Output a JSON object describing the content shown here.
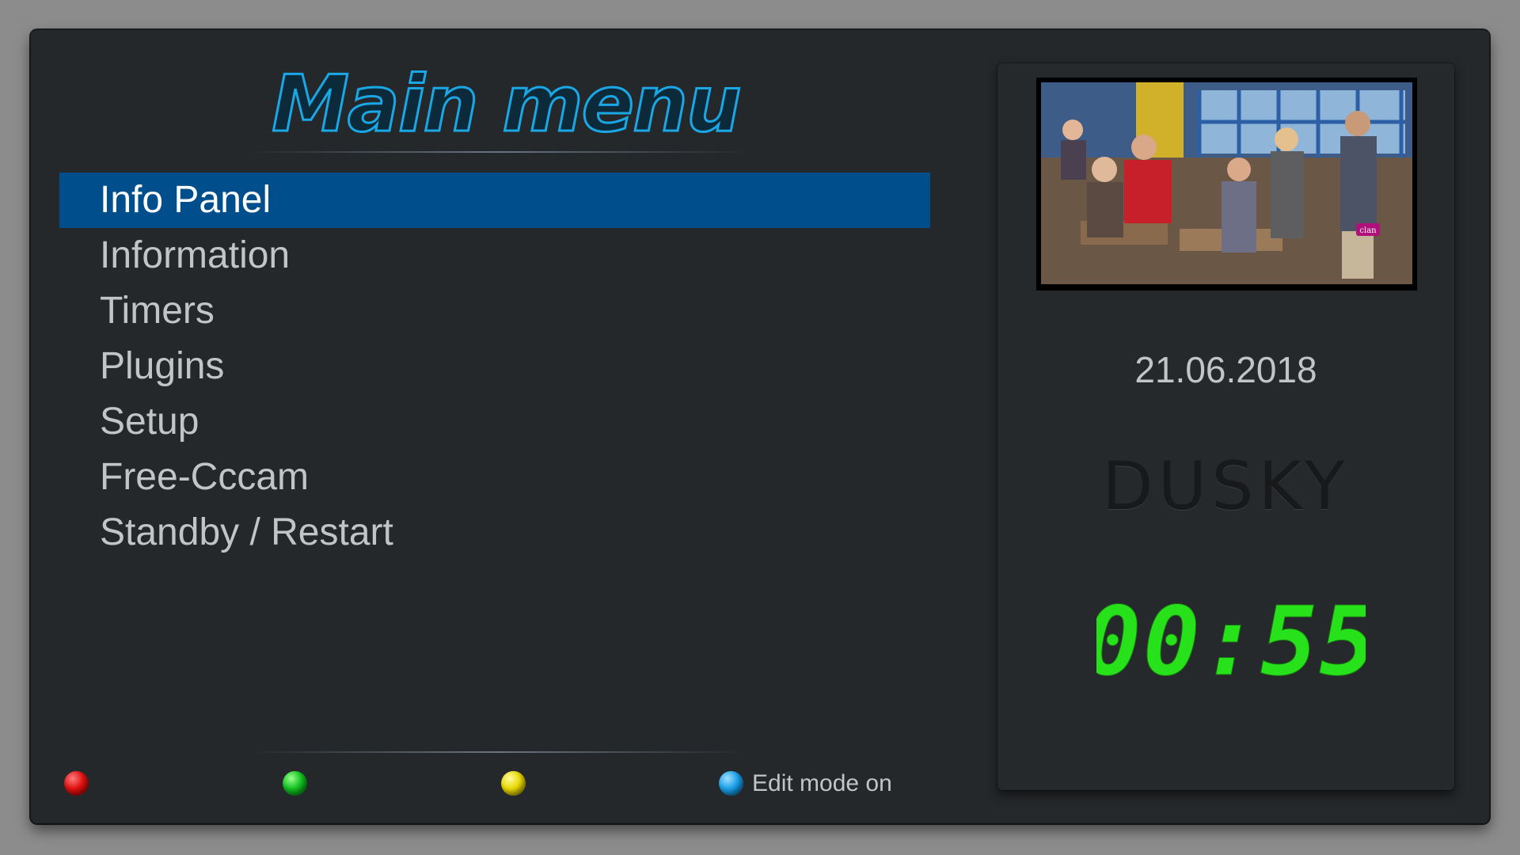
{
  "header": {
    "title": "Main menu"
  },
  "menu": {
    "items": [
      {
        "label": "Info Panel",
        "selected": true
      },
      {
        "label": "Information",
        "selected": false
      },
      {
        "label": "Timers",
        "selected": false
      },
      {
        "label": "Plugins",
        "selected": false
      },
      {
        "label": "Setup",
        "selected": false
      },
      {
        "label": "Free-Cccam",
        "selected": false
      },
      {
        "label": "Standby / Restart",
        "selected": false
      }
    ]
  },
  "colorbuttons": {
    "red": {
      "color": "#e01010"
    },
    "green": {
      "color": "#10c020"
    },
    "yellow": {
      "color": "#e8d800"
    },
    "blue": {
      "color": "#1a9fe8",
      "label": "Edit mode on"
    }
  },
  "sidepanel": {
    "date": "21.06.2018",
    "brand": "DUSKY",
    "clock": "00:55",
    "channel_logo": "clan"
  },
  "colors": {
    "accent_selected": "#004f8c",
    "title_blue": "#1aa7e6",
    "clock_green": "#27e21a"
  }
}
